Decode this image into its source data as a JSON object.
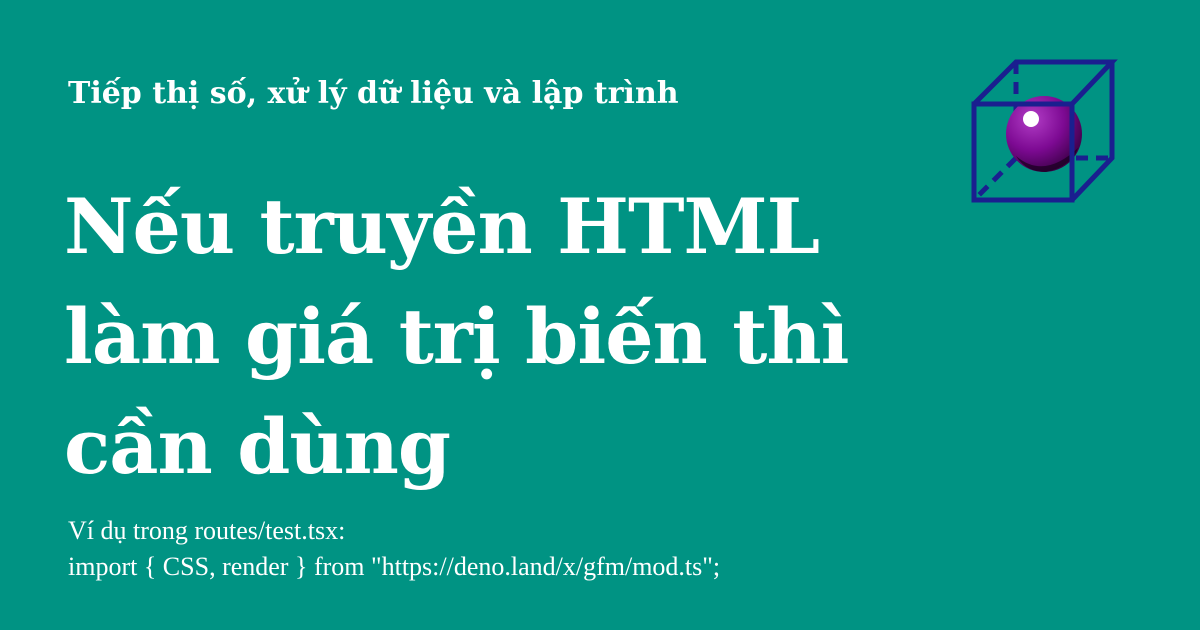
{
  "subtitle": "Tiếp thị số, xử lý dữ liệu và lập trình",
  "title": "Nếu truyền HTML làm giá trị biến thì cần dùng",
  "description": {
    "line1": "Ví dụ trong routes/test.tsx:",
    "line2": "import { CSS, render } from \"https://deno.land/x/gfm/mod.ts\";"
  },
  "logo": {
    "icon": "cube-with-sphere-icon",
    "cube_color": "#1a1f8f",
    "sphere_color": "#8a0aa0"
  },
  "colors": {
    "background": "#009383",
    "text": "#ffffff"
  }
}
